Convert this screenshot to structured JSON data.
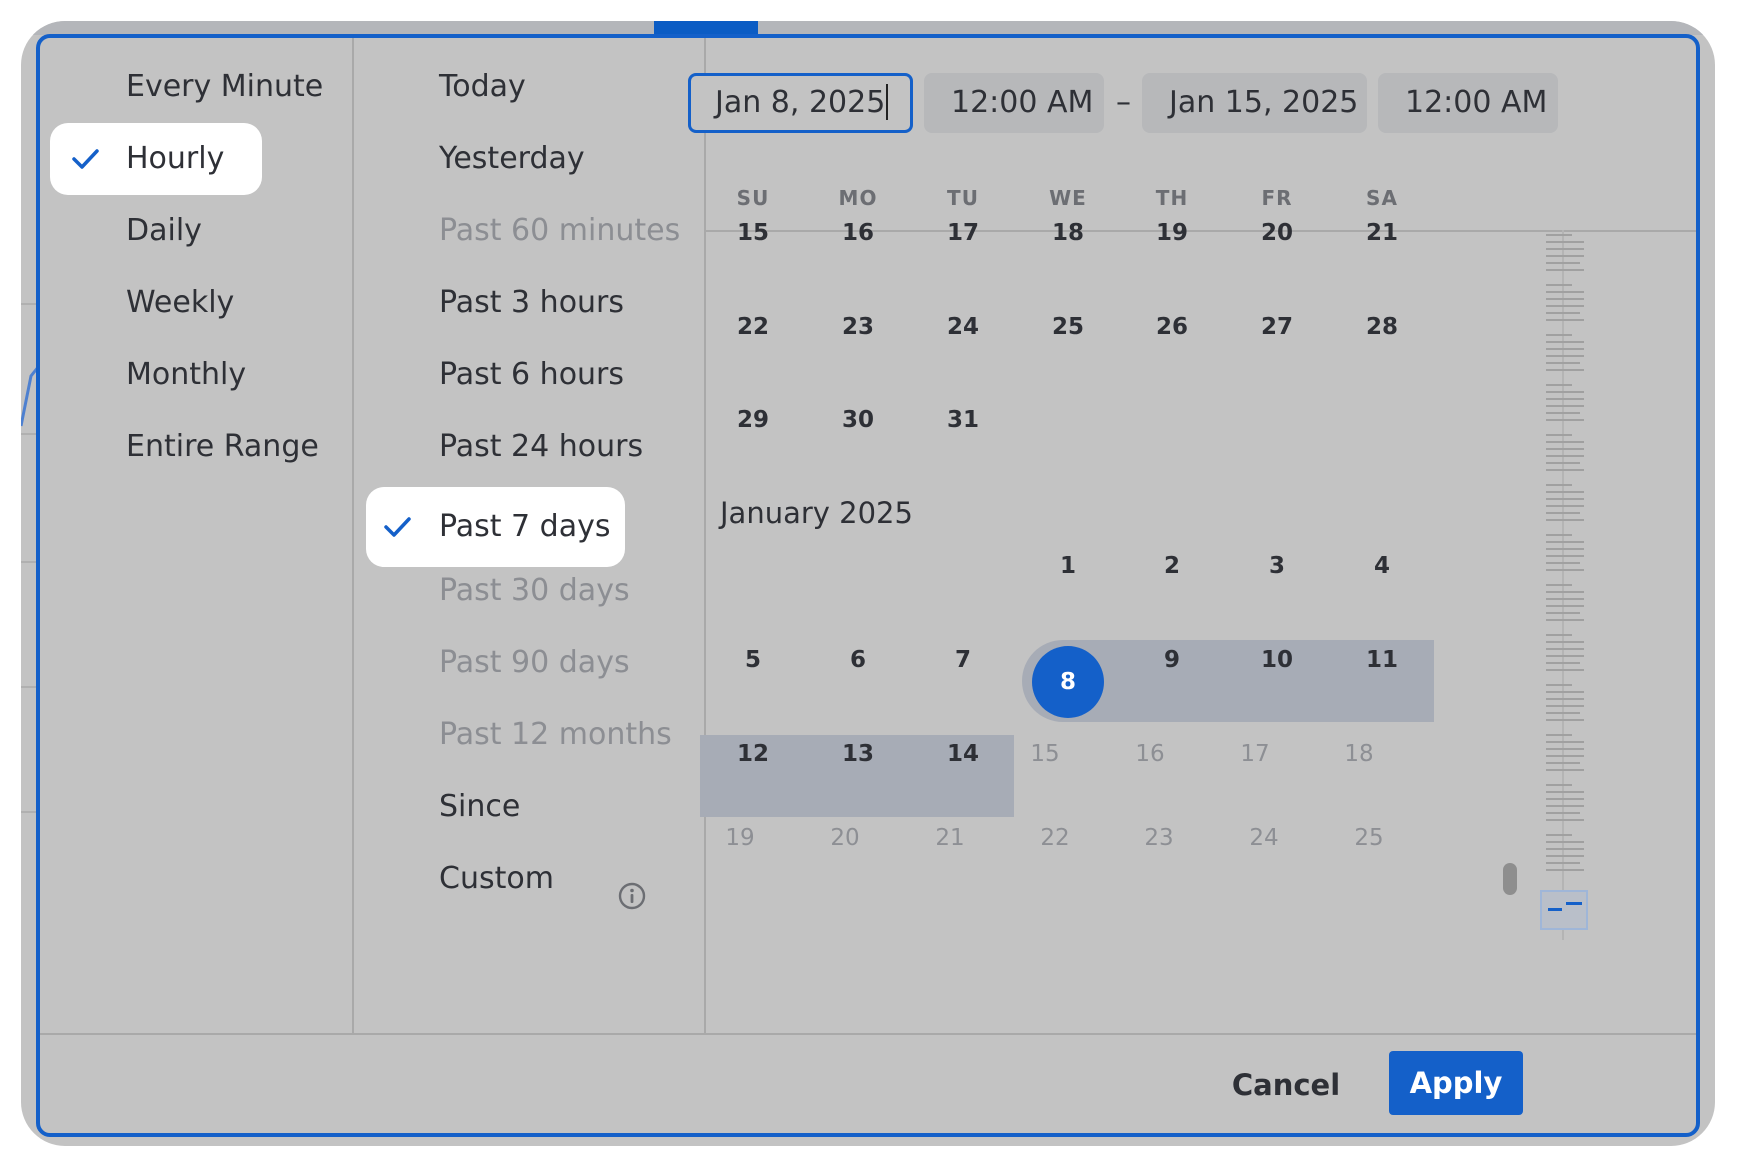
{
  "colors": {
    "accent": "#1460c9",
    "panel": "#c3c3c3",
    "range": "#a7acb6",
    "selected_bg": "#ffffff"
  },
  "granularity": {
    "items": [
      {
        "label": "Every Minute",
        "selected": false
      },
      {
        "label": "Hourly",
        "selected": true
      },
      {
        "label": "Daily",
        "selected": false
      },
      {
        "label": "Weekly",
        "selected": false
      },
      {
        "label": "Monthly",
        "selected": false
      },
      {
        "label": "Entire Range",
        "selected": false
      }
    ]
  },
  "relative": {
    "items": [
      {
        "label": "Today",
        "selected": false,
        "disabled": false
      },
      {
        "label": "Yesterday",
        "selected": false,
        "disabled": false
      },
      {
        "label": "Past 60 minutes",
        "selected": false,
        "disabled": true
      },
      {
        "label": "Past 3 hours",
        "selected": false,
        "disabled": false
      },
      {
        "label": "Past 6 hours",
        "selected": false,
        "disabled": false
      },
      {
        "label": "Past 24 hours",
        "selected": false,
        "disabled": false
      },
      {
        "label": "Past 7 days",
        "selected": true,
        "disabled": false
      },
      {
        "label": "Past 30 days",
        "selected": false,
        "disabled": true
      },
      {
        "label": "Past 90 days",
        "selected": false,
        "disabled": true
      },
      {
        "label": "Past 12 months",
        "selected": false,
        "disabled": true
      },
      {
        "label": "Since",
        "selected": false,
        "disabled": false
      },
      {
        "label": "Custom",
        "selected": false,
        "disabled": false
      }
    ],
    "custom_info_icon": "info-icon"
  },
  "range": {
    "start_date": "Jan 8, 2025",
    "start_time": "12:00 AM",
    "separator": "–",
    "end_date": "Jan 15, 2025",
    "end_time": "12:00 AM"
  },
  "calendar": {
    "weekdays": [
      "SU",
      "MO",
      "TU",
      "WE",
      "TH",
      "FR",
      "SA"
    ],
    "prev_month_rows": [
      [
        "15",
        "16",
        "17",
        "18",
        "19",
        "20",
        "21"
      ],
      [
        "22",
        "23",
        "24",
        "25",
        "26",
        "27",
        "28"
      ],
      [
        "29",
        "30",
        "31",
        "",
        "",
        "",
        ""
      ]
    ],
    "month_label": "January 2025",
    "month_rows": [
      [
        "",
        "",
        "",
        "1",
        "2",
        "3",
        "4"
      ],
      [
        "5",
        "6",
        "7",
        "8",
        "9",
        "10",
        "11"
      ],
      [
        "12",
        "13",
        "14",
        "15",
        "16",
        "17",
        "18"
      ],
      [
        "19",
        "20",
        "21",
        "22",
        "23",
        "24",
        "25"
      ]
    ],
    "selected_day": "8",
    "in_range_days": [
      "8",
      "9",
      "10",
      "11",
      "12",
      "13",
      "14"
    ]
  },
  "footer": {
    "cancel_label": "Cancel",
    "apply_label": "Apply"
  }
}
